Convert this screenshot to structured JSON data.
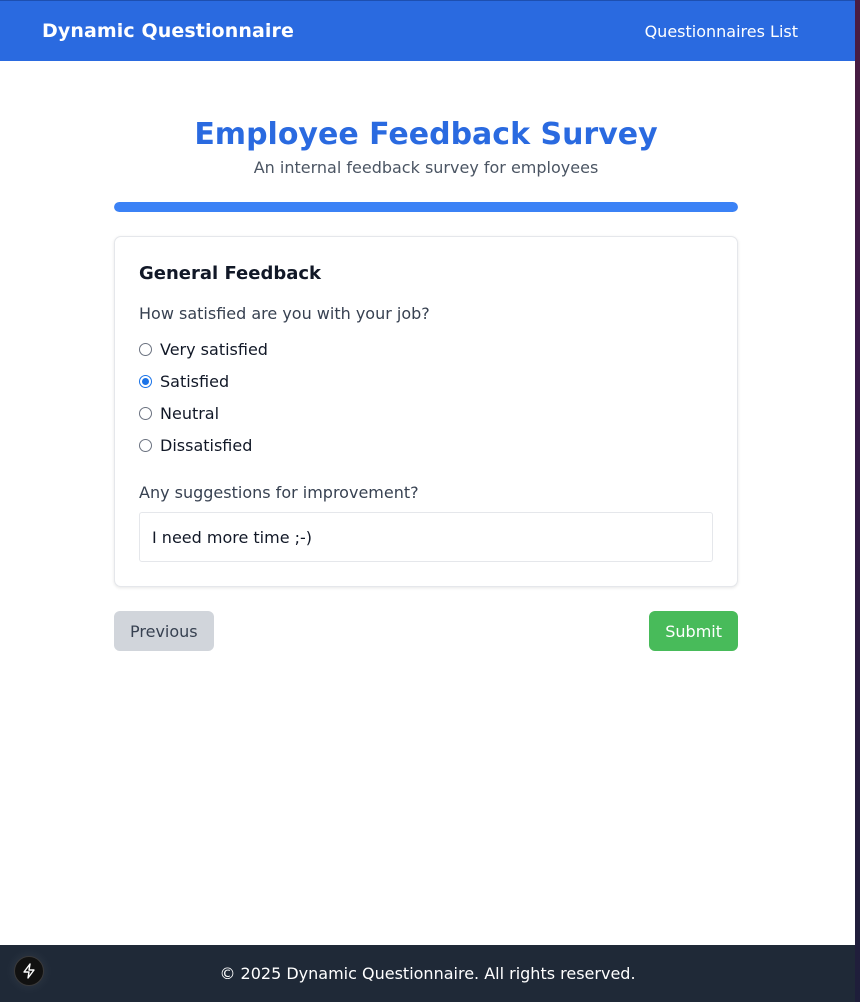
{
  "navbar": {
    "brand": "Dynamic Questionnaire",
    "link": "Questionnaires List"
  },
  "survey": {
    "title": "Employee Feedback Survey",
    "subtitle": "An internal feedback survey for employees",
    "progress_percent": 100
  },
  "section": {
    "title": "General Feedback",
    "question1": {
      "label": "How satisfied are you with your job?",
      "options": [
        "Very satisfied",
        "Satisfied",
        "Neutral",
        "Dissatisfied"
      ],
      "selected": "Satisfied"
    },
    "question2": {
      "label": "Any suggestions for improvement?",
      "value": "I need more time ;-)"
    }
  },
  "buttons": {
    "previous": "Previous",
    "submit": "Submit"
  },
  "footer": {
    "text": "© 2025 Dynamic Questionnaire. All rights reserved."
  },
  "colors": {
    "primary": "#2a6ae0",
    "progress": "#3b82f6",
    "submit": "#48bb5a",
    "footer": "#1f2937"
  },
  "icons": {
    "floating_button": "lightning-bolt-icon"
  }
}
